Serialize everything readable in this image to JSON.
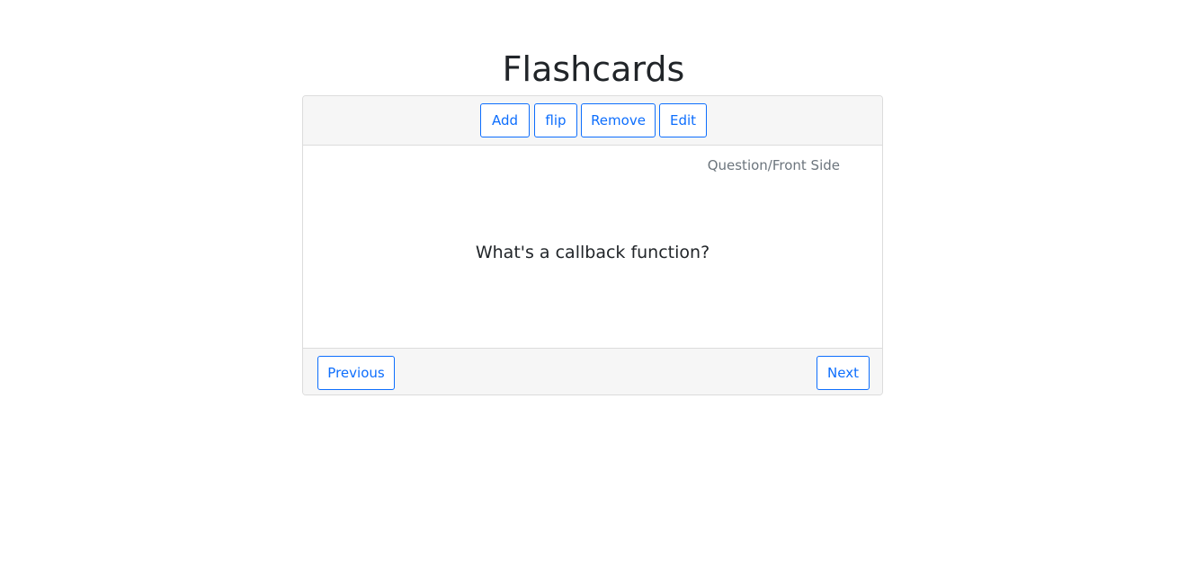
{
  "page": {
    "title": "Flashcards"
  },
  "toolbar": {
    "add_label": "Add",
    "flip_label": "flip",
    "remove_label": "Remove",
    "edit_label": "Edit"
  },
  "card": {
    "side_label": "Question/Front Side",
    "text": "What's a callback function?"
  },
  "navigation": {
    "previous_label": "Previous",
    "next_label": "Next"
  },
  "colors": {
    "accent": "#0d6efd",
    "header_bg": "#f6f6f6",
    "muted_text": "#6c757d"
  }
}
